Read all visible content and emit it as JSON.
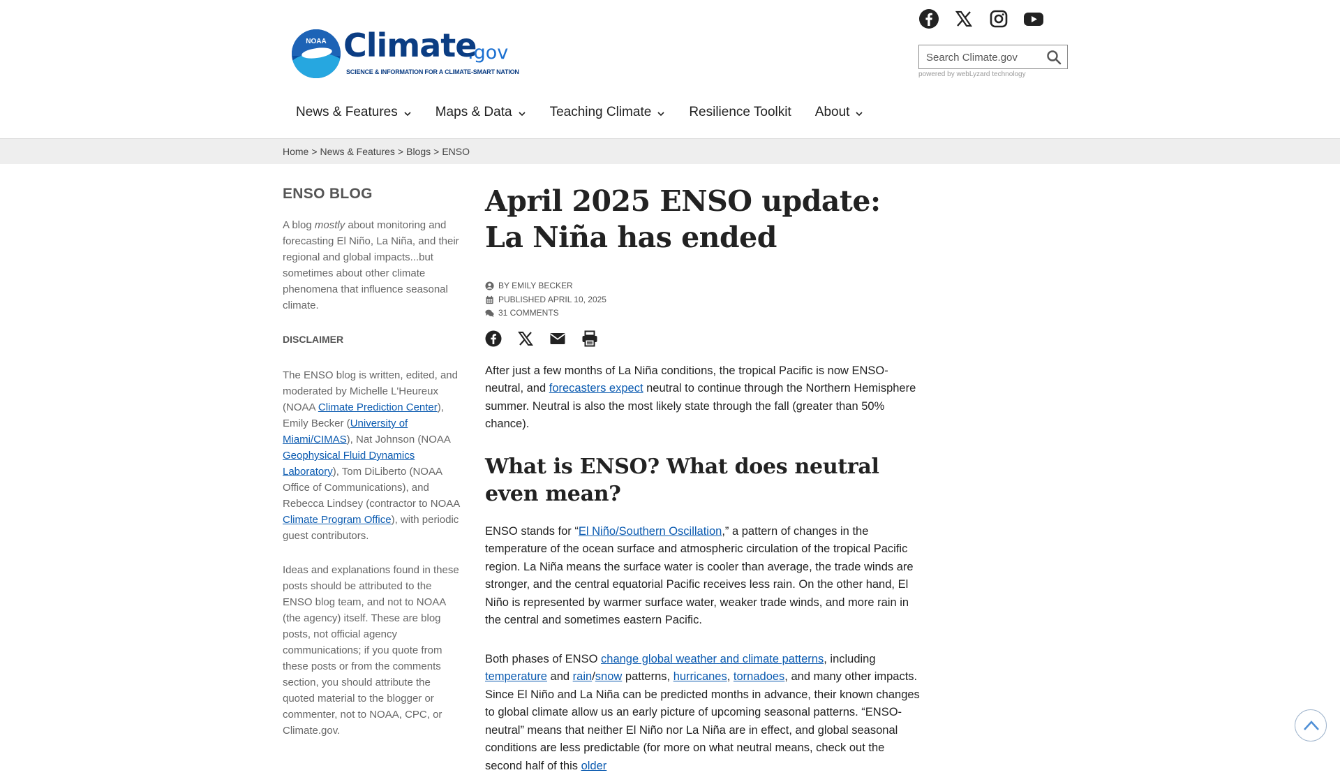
{
  "logo": {
    "seal_text": "NOAA",
    "wordmark": "Climate",
    "tld": ".gov",
    "tagline": "SCIENCE & INFORMATION FOR A CLIMATE-SMART NATION",
    "brand_color": "#0b3d83"
  },
  "social": [
    "facebook-icon",
    "x-icon",
    "instagram-icon",
    "youtube-icon"
  ],
  "search": {
    "placeholder": "Search Climate.gov",
    "powered_by": "powered by webLyzard technology"
  },
  "nav": {
    "items": [
      {
        "label": "News & Features",
        "dropdown": true
      },
      {
        "label": "Maps & Data",
        "dropdown": true
      },
      {
        "label": "Teaching Climate",
        "dropdown": true
      },
      {
        "label": "Resilience Toolkit",
        "dropdown": false
      },
      {
        "label": "About",
        "dropdown": true
      }
    ]
  },
  "breadcrumb": [
    "Home",
    "News & Features",
    "Blogs",
    "ENSO"
  ],
  "sidebar": {
    "title": "ENSO BLOG",
    "intro_pre": "A blog ",
    "intro_em": "mostly",
    "intro_post": " about monitoring and forecasting El Niño, La Niña, and their regional and global impacts...but sometimes about other climate phenomena that influence seasonal climate.",
    "disclaimer_heading": "DISCLAIMER",
    "d1": "The ENSO blog is written, edited, and moderated by Michelle L'Heureux (NOAA ",
    "d1_link": "Climate Prediction Center",
    "d2": "), Emily Becker (",
    "d2_link": "University of Miami/CIMAS",
    "d3": "), Nat Johnson (NOAA ",
    "d3_link": "Geophysical Fluid Dynamics Laboratory",
    "d4": "), Tom DiLiberto (NOAA Office of Communications), and Rebecca Lindsey (contractor to NOAA ",
    "d4_link": "Climate Program Office",
    "d5": "), with periodic guest contributors.",
    "ideas": "Ideas and explanations found in these posts should be attributed to the ENSO blog team, and not to NOAA (the agency) itself. These are blog posts, not official agency communications; if you quote from these posts or from the comments section, you should attribute the quoted material to the blogger or commenter, not to NOAA, CPC, or Climate.gov."
  },
  "article": {
    "title": "April 2025 ENSO update: La Niña has ended",
    "author": "BY EMILY BECKER",
    "published": "PUBLISHED APRIL 10, 2025",
    "comments": "31 COMMENTS",
    "share": [
      "facebook-icon",
      "x-icon",
      "email-icon",
      "print-icon"
    ],
    "p1_a": "After just a few months of La Niña conditions, the tropical Pacific is now ENSO-neutral, and ",
    "p1_link": "forecasters expect",
    "p1_b": " neutral to continue through the Northern Hemisphere summer. Neutral is also the most likely state through the fall (greater than 50% chance).",
    "h2": "What is ENSO? What does neutral even mean?",
    "p2_a": "ENSO stands for “",
    "p2_link": "El Niño/Southern Oscillation",
    "p2_b": ",” a pattern of changes in the temperature of the ocean surface and atmospheric circulation of the tropical Pacific region. La Niña means the surface water is cooler than average, the trade winds are stronger, and the central equatorial Pacific receives less rain. On the other hand, El Niño is represented by warmer surface water, weaker trade winds, and more rain in the central and sometimes eastern Pacific.",
    "p3_a": "Both phases of ENSO ",
    "p3_link1": "change global weather and climate patterns",
    "p3_b": ", including ",
    "p3_link2": "temperature",
    "p3_c": " and ",
    "p3_link3": "rain",
    "p3_d": "/",
    "p3_link4": "snow",
    "p3_e": " patterns, ",
    "p3_link5": "hurricanes",
    "p3_f": ", ",
    "p3_link6": "tornadoes",
    "p3_g": ", and many other impacts. Since El Niño and La Niña can be predicted months in advance, their known changes to global climate allow us an early picture of upcoming seasonal patterns. “ENSO-neutral” means that neither El Niño nor La Niña are in effect, and global seasonal conditions are less predictable (for more on what neutral means, check out the second half of this ",
    "p3_link7": "older"
  },
  "colors": {
    "link": "#0a5ab0",
    "breadcrumb_bg": "#eeeeee",
    "text": "#222222",
    "sidebar_text": "#666666"
  }
}
